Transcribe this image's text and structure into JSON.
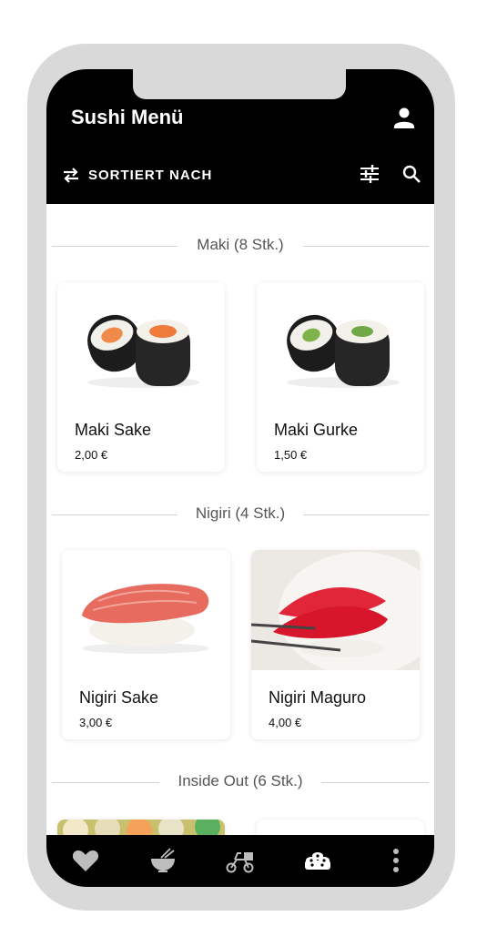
{
  "app": {
    "title": "Sushi Menü"
  },
  "toolbar": {
    "sort_label": "SORTIERT NACH"
  },
  "sections": [
    {
      "label": "Maki (8 Stk.)",
      "items": [
        {
          "name": "Maki Sake",
          "price": "2,00 €"
        },
        {
          "name": "Maki Gurke",
          "price": "1,50 €"
        }
      ]
    },
    {
      "label": "Nigiri (4 Stk.)",
      "items": [
        {
          "name": "Nigiri Sake",
          "price": "3,00 €"
        },
        {
          "name": "Nigiri Maguro",
          "price": "4,00 €"
        }
      ]
    },
    {
      "label": "Inside Out (6 Stk.)",
      "items": []
    }
  ],
  "icons": {
    "profile": "person-icon",
    "sort": "swap-arrows-icon",
    "filter": "sliders-icon",
    "search": "search-icon",
    "nav": [
      "heart-icon",
      "bowl-chopsticks-icon",
      "delivery-scooter-icon",
      "sushi-rolls-icon",
      "more-vert-icon"
    ]
  },
  "colors": {
    "bar": "#000000",
    "frame": "#d9d9d9",
    "nav_inactive": "#bdbdbd",
    "nav_active": "#ffffff"
  }
}
